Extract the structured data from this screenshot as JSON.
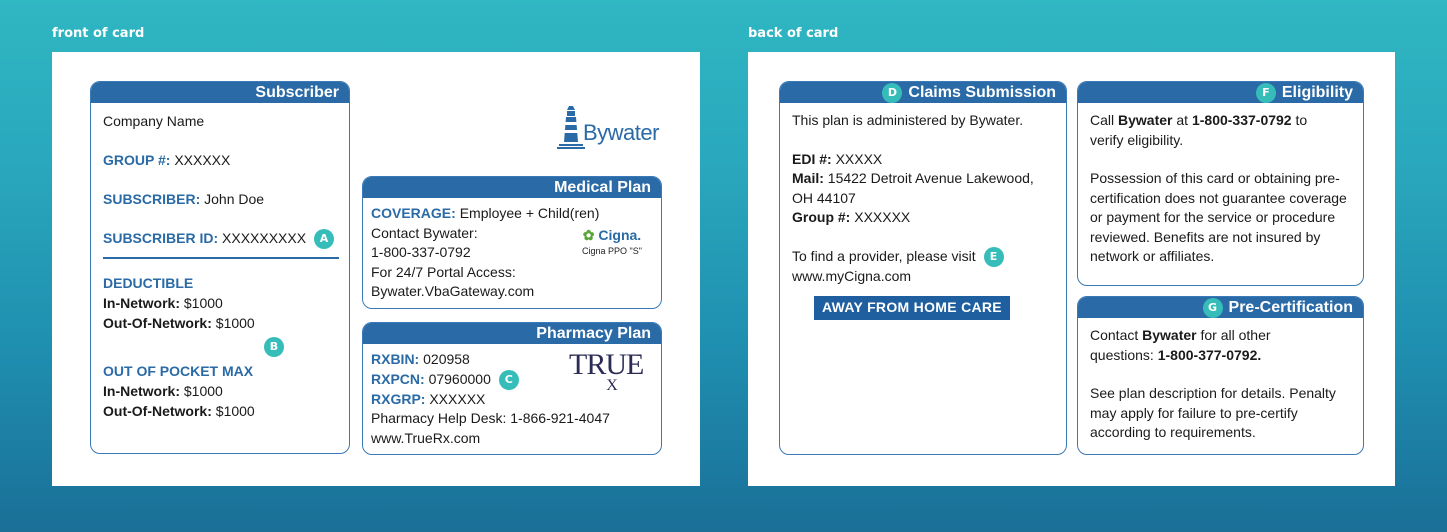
{
  "front_label": "front of card",
  "back_label": "back of card",
  "front": {
    "subscriber": {
      "title": "Subscriber",
      "company": "Company Name",
      "group_label": "GROUP #:",
      "group_value": "XXXXXX",
      "subscriber_label": "SUBSCRIBER:",
      "subscriber_value": "John Doe",
      "subscriber_id_label": "SUBSCRIBER ID:",
      "subscriber_id_value": "XXXXXXXXX",
      "badge_a": "A",
      "deductible_label": "DEDUCTIBLE",
      "ded_in_label": "In-Network:",
      "ded_in_value": "$1000",
      "ded_out_label": "Out-Of-Network:",
      "ded_out_value": "$1000",
      "badge_b": "B",
      "oop_label": "OUT OF POCKET MAX",
      "oop_in_label": "In-Network:",
      "oop_in_value": "$1000",
      "oop_out_label": "Out-Of-Network:",
      "oop_out_value": "$1000"
    },
    "logo": {
      "text": "Bywater",
      "color": "#2a6aa6"
    },
    "medical": {
      "title": "Medical Plan",
      "coverage_label": "COVERAGE:",
      "coverage_value": "Employee + Child(ren)",
      "contact_line": "Contact Bywater:",
      "phone": "1-800-337-0792",
      "portal_line": "For 24/7 Portal Access:",
      "portal_url": "Bywater.VbaGateway.com",
      "cigna_logo": "Cigna.",
      "cigna_plan": "Cigna PPO \"S\""
    },
    "pharmacy": {
      "title": "Pharmacy Plan",
      "rxbin_label": "RXBIN:",
      "rxbin_value": "020958",
      "rxpcn_label": "RXPCN:",
      "rxpcn_value": "07960000",
      "badge_c": "C",
      "rxgrp_label": "RXGRP:",
      "rxgrp_value": "XXXXXX",
      "help_line": "Pharmacy Help Desk: 1-866-921-4047",
      "url": "www.TrueRx.com",
      "truerx_logo_main": "TRUE",
      "truerx_logo_sub": "X"
    }
  },
  "back": {
    "claims": {
      "badge_d": "D",
      "title": "Claims Submission",
      "admin_line": "This plan is administered by Bywater.",
      "edi_label": "EDI #:",
      "edi_value": "XXXXX",
      "mail_label": "Mail:",
      "mail_value": "15422 Detroit Avenue Lakewood,",
      "mail_value2": "OH 44107",
      "group_label": "Group #:",
      "group_value": "XXXXXX",
      "provider_line": "To find a provider, please visit",
      "badge_e": "E",
      "provider_url": "www.myCigna.com",
      "away_label": "AWAY FROM HOME CARE"
    },
    "eligibility": {
      "badge_f": "F",
      "title": "Eligibility",
      "line1_pre": "Call",
      "line1_name": "Bywater",
      "line1_mid": "at",
      "line1_phone": "1-800-337-0792",
      "line1_post": "to",
      "line2": "verify eligibility.",
      "para": "Possession of this card or obtaining pre-certification does not guarantee coverage or payment for the service or procedure reviewed. Benefits are not insured by network or affiliates."
    },
    "precert": {
      "badge_g": "G",
      "title": "Pre-Certification",
      "contact_pre": "Contact",
      "contact_name": "Bywater",
      "contact_post": "for all other",
      "questions_pre": "questions:",
      "questions_phone": "1-800-377-0792.",
      "para": "See plan description for details. Penalty may apply for failure to pre-certify according to requirements."
    }
  }
}
